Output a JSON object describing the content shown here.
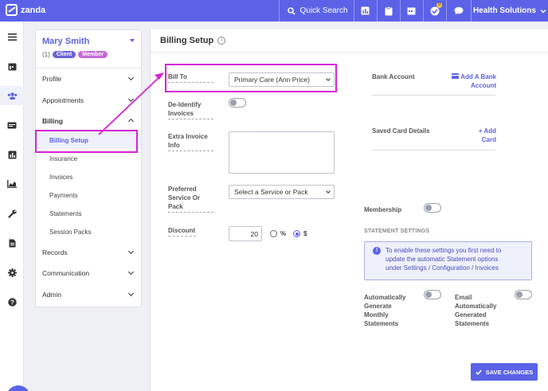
{
  "topbar": {
    "brand": "zanda",
    "quick_search": "Quick Search",
    "notification_count": "0",
    "org_name": "Health Solutions"
  },
  "client": {
    "name": "Mary Smith",
    "count": "(1)",
    "tag_client": "Client",
    "tag_member": "Member"
  },
  "nav": {
    "profile": "Profile",
    "appointments": "Appointments",
    "billing": "Billing",
    "billing_items": [
      "Billing Setup",
      "Insurance",
      "Invoices",
      "Payments",
      "Statements",
      "Session Packs"
    ],
    "records": "Records",
    "communication": "Communication",
    "admin": "Admin"
  },
  "page": {
    "title": "Billing Setup"
  },
  "form": {
    "bill_to_label": "Bill To",
    "bill_to_value": "Primary Care (Ann Price)",
    "deidentify_label_1": "De-Identify",
    "deidentify_label_2": "Invoices",
    "extra_info_label_1": "Extra Invoice",
    "extra_info_label_2": "Info",
    "pref_service_label_1": "Preferred",
    "pref_service_label_2": "Service Or",
    "pref_service_label_3": "Pack",
    "pref_service_placeholder": "Select a Service or Pack",
    "discount_label": "Discount",
    "discount_value": "20",
    "discount_percent": "%",
    "discount_dollar": "$"
  },
  "right": {
    "bank_account_label": "Bank Account",
    "add_bank_1": "Add A Bank",
    "add_bank_2": "Account",
    "saved_card_label": "Saved Card Details",
    "add_card_1": "Add",
    "add_card_2": "Card",
    "membership_label": "Membership",
    "statement_settings": "STATEMENT SETTINGS",
    "statement_info_1": "To enable these settings you first need to",
    "statement_info_2": "update the automatic Statement options",
    "statement_info_3": "under Settings / Configuration / Invoices",
    "auto_gen_1": "Automatically",
    "auto_gen_2": "Generate",
    "auto_gen_3": "Monthly",
    "auto_gen_4": "Statements",
    "email_auto_1": "Email",
    "email_auto_2": "Automatically",
    "email_auto_3": "Generated",
    "email_auto_4": "Statements"
  },
  "save_button": "SAVE CHANGES",
  "colors": {
    "brand": "#5b62e8",
    "highlight": "#d623d6",
    "client_tag": "#6a62d8",
    "member_tag": "#c56ad8"
  }
}
